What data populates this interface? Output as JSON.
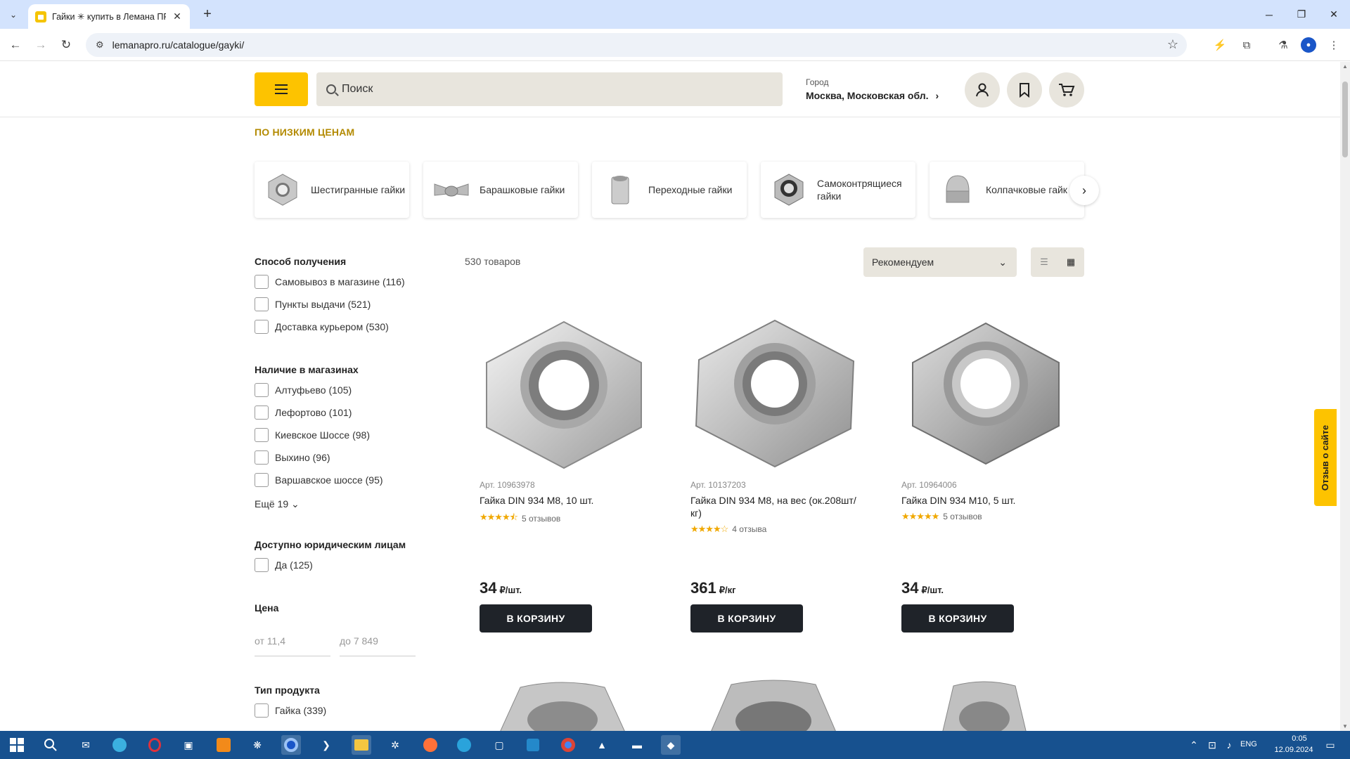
{
  "browser": {
    "tab_title": "Гайки ✳ купить в Лемана ПРО",
    "tab_close": "✕",
    "new_tab": "+",
    "url": "lemanapro.ru/catalogue/gayki/",
    "window_controls": [
      "─",
      "❐",
      "✕"
    ]
  },
  "header": {
    "search_placeholder": "Поиск",
    "city_label": "Город",
    "city_name": "Москва, Московская обл."
  },
  "section_title": "ПО НИЗКИМ ЦЕНАМ",
  "categories": [
    {
      "label": "Шестигранные гайки"
    },
    {
      "label": "Барашковые гайки"
    },
    {
      "label": "Переходные гайки"
    },
    {
      "label": "Самоконтрящиеся гайки"
    },
    {
      "label": "Колпачковые гайк"
    }
  ],
  "filters": {
    "delivery_title": "Способ получения",
    "delivery": [
      "Самовывоз в магазине (116)",
      "Пункты выдачи (521)",
      "Доставка курьером (530)"
    ],
    "stores_title": "Наличие в магазинах",
    "stores": [
      "Алтуфьево (105)",
      "Лефортово (101)",
      "Киевское Шоссе (98)",
      "Выхино (96)",
      "Варшавское шоссе (95)"
    ],
    "more": "Ещё 19",
    "legal_title": "Доступно юридическим лицам",
    "legal": [
      "Да (125)"
    ],
    "price_title": "Цена",
    "price_from": "от  11,4",
    "price_to": "до  7 849",
    "type_title": "Тип продукта",
    "types": [
      "Гайка (339)"
    ]
  },
  "listing": {
    "count": "530 товаров",
    "sort": "Рекомендуем"
  },
  "products": [
    {
      "art": "Арт. 10963978",
      "name": "Гайка DIN 934 M8, 10 шт.",
      "rating": 4.5,
      "reviews": "5 отзывов",
      "price": "34",
      "unit": "₽/шт.",
      "button": "В КОРЗИНУ"
    },
    {
      "art": "Арт. 10137203",
      "name": "Гайка DIN 934 M8, на вес (ок.208шт/кг)",
      "rating": 4,
      "reviews": "4 отзыва",
      "price": "361",
      "unit": "₽/кг",
      "button": "В КОРЗИНУ"
    },
    {
      "art": "Арт. 10964006",
      "name": "Гайка DIN 934 M10, 5 шт.",
      "rating": 5,
      "reviews": "5 отзывов",
      "price": "34",
      "unit": "₽/шт.",
      "button": "В КОРЗИНУ"
    }
  ],
  "feedback": "Отзыв о сайте",
  "taskbar": {
    "lang": "ENG",
    "time": "0:05",
    "date": "12.09.2024"
  },
  "colors": {
    "brand_yellow": "#fdc300",
    "section_title": "#b38a00",
    "button_dark": "#1f2329",
    "taskbar": "#17518f"
  }
}
